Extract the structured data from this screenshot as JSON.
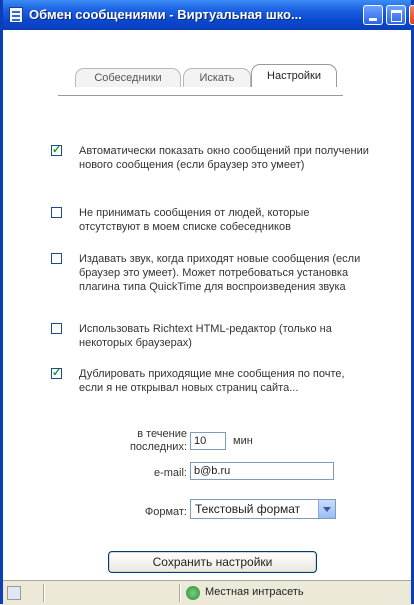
{
  "window": {
    "title": "Обмен сообщениями - Виртуальная шко..."
  },
  "tabs": [
    {
      "label": "Собеседники"
    },
    {
      "label": "Искать"
    },
    {
      "label": "Настройки"
    }
  ],
  "options": [
    {
      "checked": true,
      "label": "Автоматически показать окно сообщений при получении нового сообщения (если браузер это умеет)"
    },
    {
      "checked": false,
      "label": "Не принимать сообщения от людей, которые отсутствуют в моем списке собеседников"
    },
    {
      "checked": false,
      "label": "Издавать звук, когда приходят новые сообщения (если браузер это умеет). Может потребоваться установка плагина типа QuickTime для воспроизведения звука"
    },
    {
      "checked": false,
      "label": "Использовать Richtext HTML-редактор (только на некоторых браузерах)"
    },
    {
      "checked": true,
      "label": "Дублировать приходящие мне сообщения по почте, если я не открывал новых страниц сайта..."
    }
  ],
  "form": {
    "period_label": "в течение последних:",
    "period_value": "10",
    "period_unit": "мин",
    "email_label": "e-mail:",
    "email_value": "b@b.ru",
    "format_label": "Формат:",
    "format_value": "Текстовый формат"
  },
  "save_button": "Сохранить настройки",
  "statusbar": {
    "zone": "Местная интрасеть"
  }
}
